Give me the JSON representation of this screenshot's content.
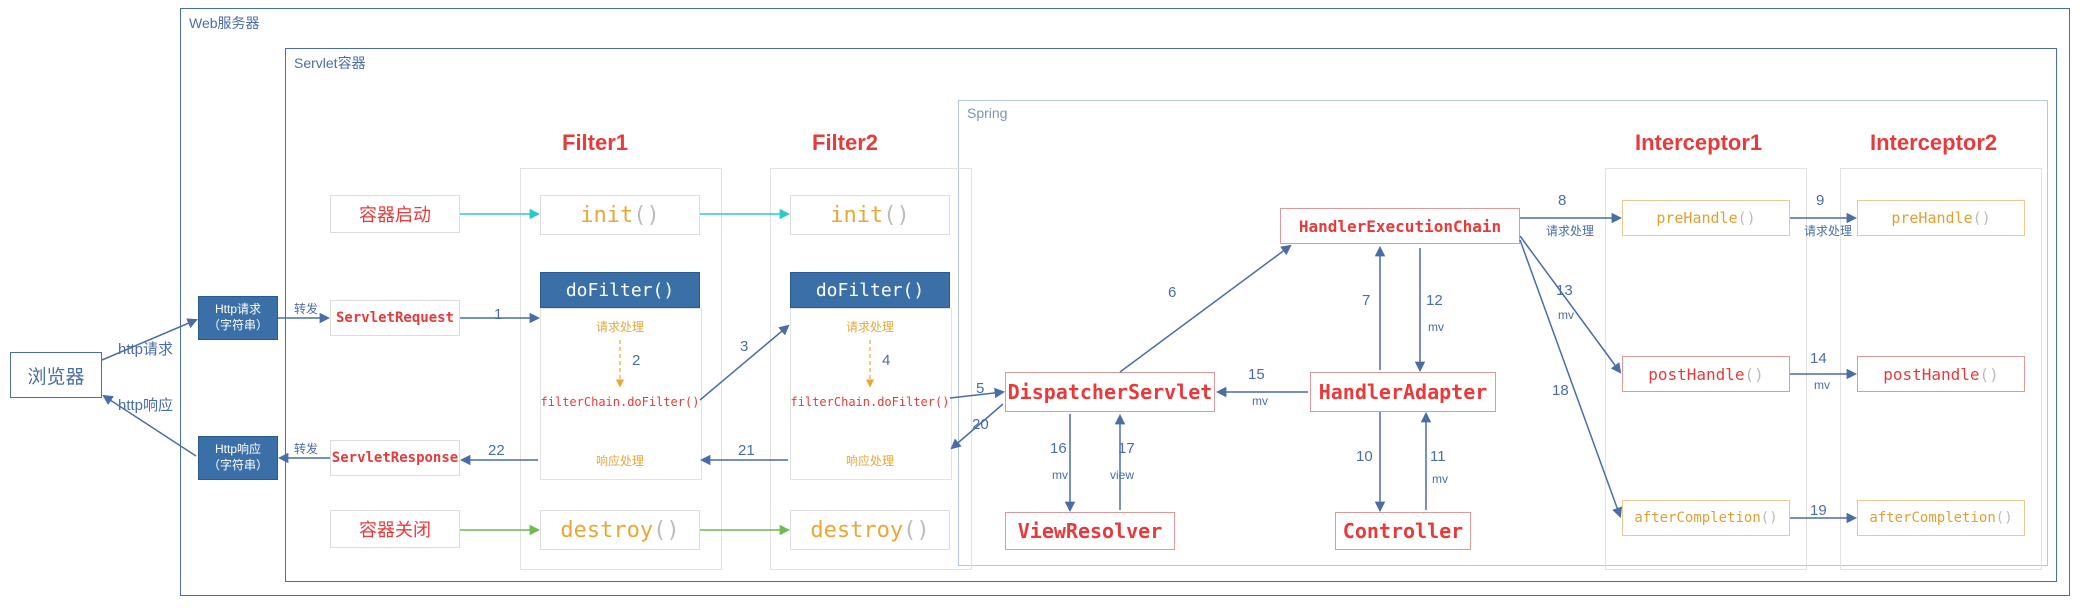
{
  "browser": "浏览器",
  "http_request": "http请求",
  "http_response": "http响应",
  "web_server": "Web服务器",
  "servlet_container": "Servlet容器",
  "spring": "Spring",
  "http_req_box": "Http请求\n（字符串）",
  "http_res_box": "Http响应\n（字符串）",
  "forward": "转发",
  "servlet_request": "ServletRequest",
  "servlet_response": "ServletResponse",
  "container_start": "容器启动",
  "container_stop": "容器关闭",
  "filters": {
    "filter1": "Filter1",
    "filter2": "Filter2",
    "init": "init",
    "destroy": "destroy",
    "doFilter": "doFilter()",
    "req_process": "请求处理",
    "res_process": "响应处理",
    "chain": "filterChain.doFilter()",
    "parens": "()"
  },
  "spring_nodes": {
    "dispatcher": "DispatcherServlet",
    "hec": "HandlerExecutionChain",
    "adapter": "HandlerAdapter",
    "controller": "Controller",
    "view_resolver": "ViewResolver",
    "interceptor1": "Interceptor1",
    "interceptor2": "Interceptor2",
    "preHandle": "preHandle",
    "postHandle": "postHandle",
    "afterCompletion": "afterCompletion"
  },
  "steps": {
    "s1": "1",
    "s2": "2",
    "s3": "3",
    "s4": "4",
    "s5": "5",
    "s6": "6",
    "s7": "7",
    "s8": "8",
    "s9": "9",
    "s10": "10",
    "s11": "11",
    "s12": "12",
    "s13": "13",
    "s14": "14",
    "s15": "15",
    "s16": "16",
    "s17": "17",
    "s18": "18",
    "s19": "19",
    "s20": "20",
    "s21": "21",
    "s22": "22"
  },
  "notes": {
    "mv": "mv",
    "view": "view",
    "req_process": "请求处理"
  }
}
